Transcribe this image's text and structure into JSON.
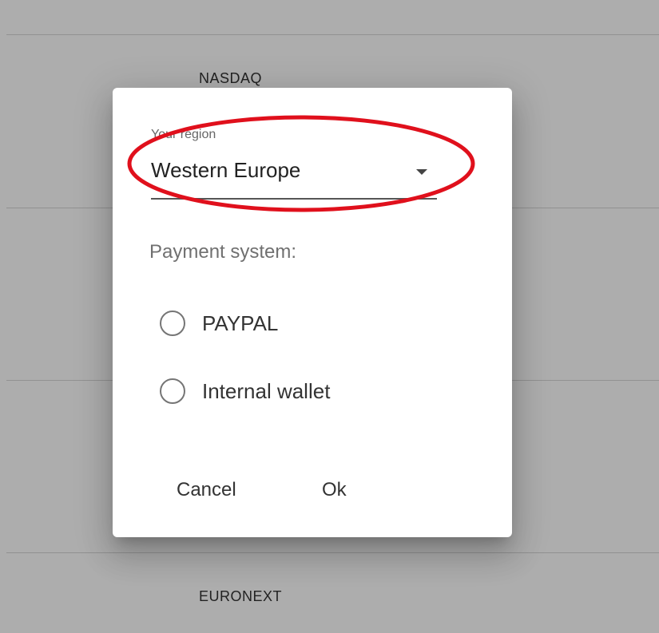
{
  "background": {
    "rows": [
      {
        "label": ""
      },
      {
        "label": "NASDAQ"
      },
      {
        "label": ""
      },
      {
        "label": ""
      },
      {
        "label": ""
      },
      {
        "label": "EURONEXT"
      }
    ]
  },
  "dialog": {
    "region_field": {
      "label": "Your region",
      "value": "Western Europe"
    },
    "payment_label": "Payment system:",
    "payment_options": [
      {
        "label": "PAYPAL",
        "selected": false
      },
      {
        "label": "Internal wallet",
        "selected": false
      }
    ],
    "cancel_label": "Cancel",
    "ok_label": "Ok"
  },
  "colors": {
    "highlight": "#e0101c",
    "overlay": "rgba(0,0,0,0.32)"
  }
}
